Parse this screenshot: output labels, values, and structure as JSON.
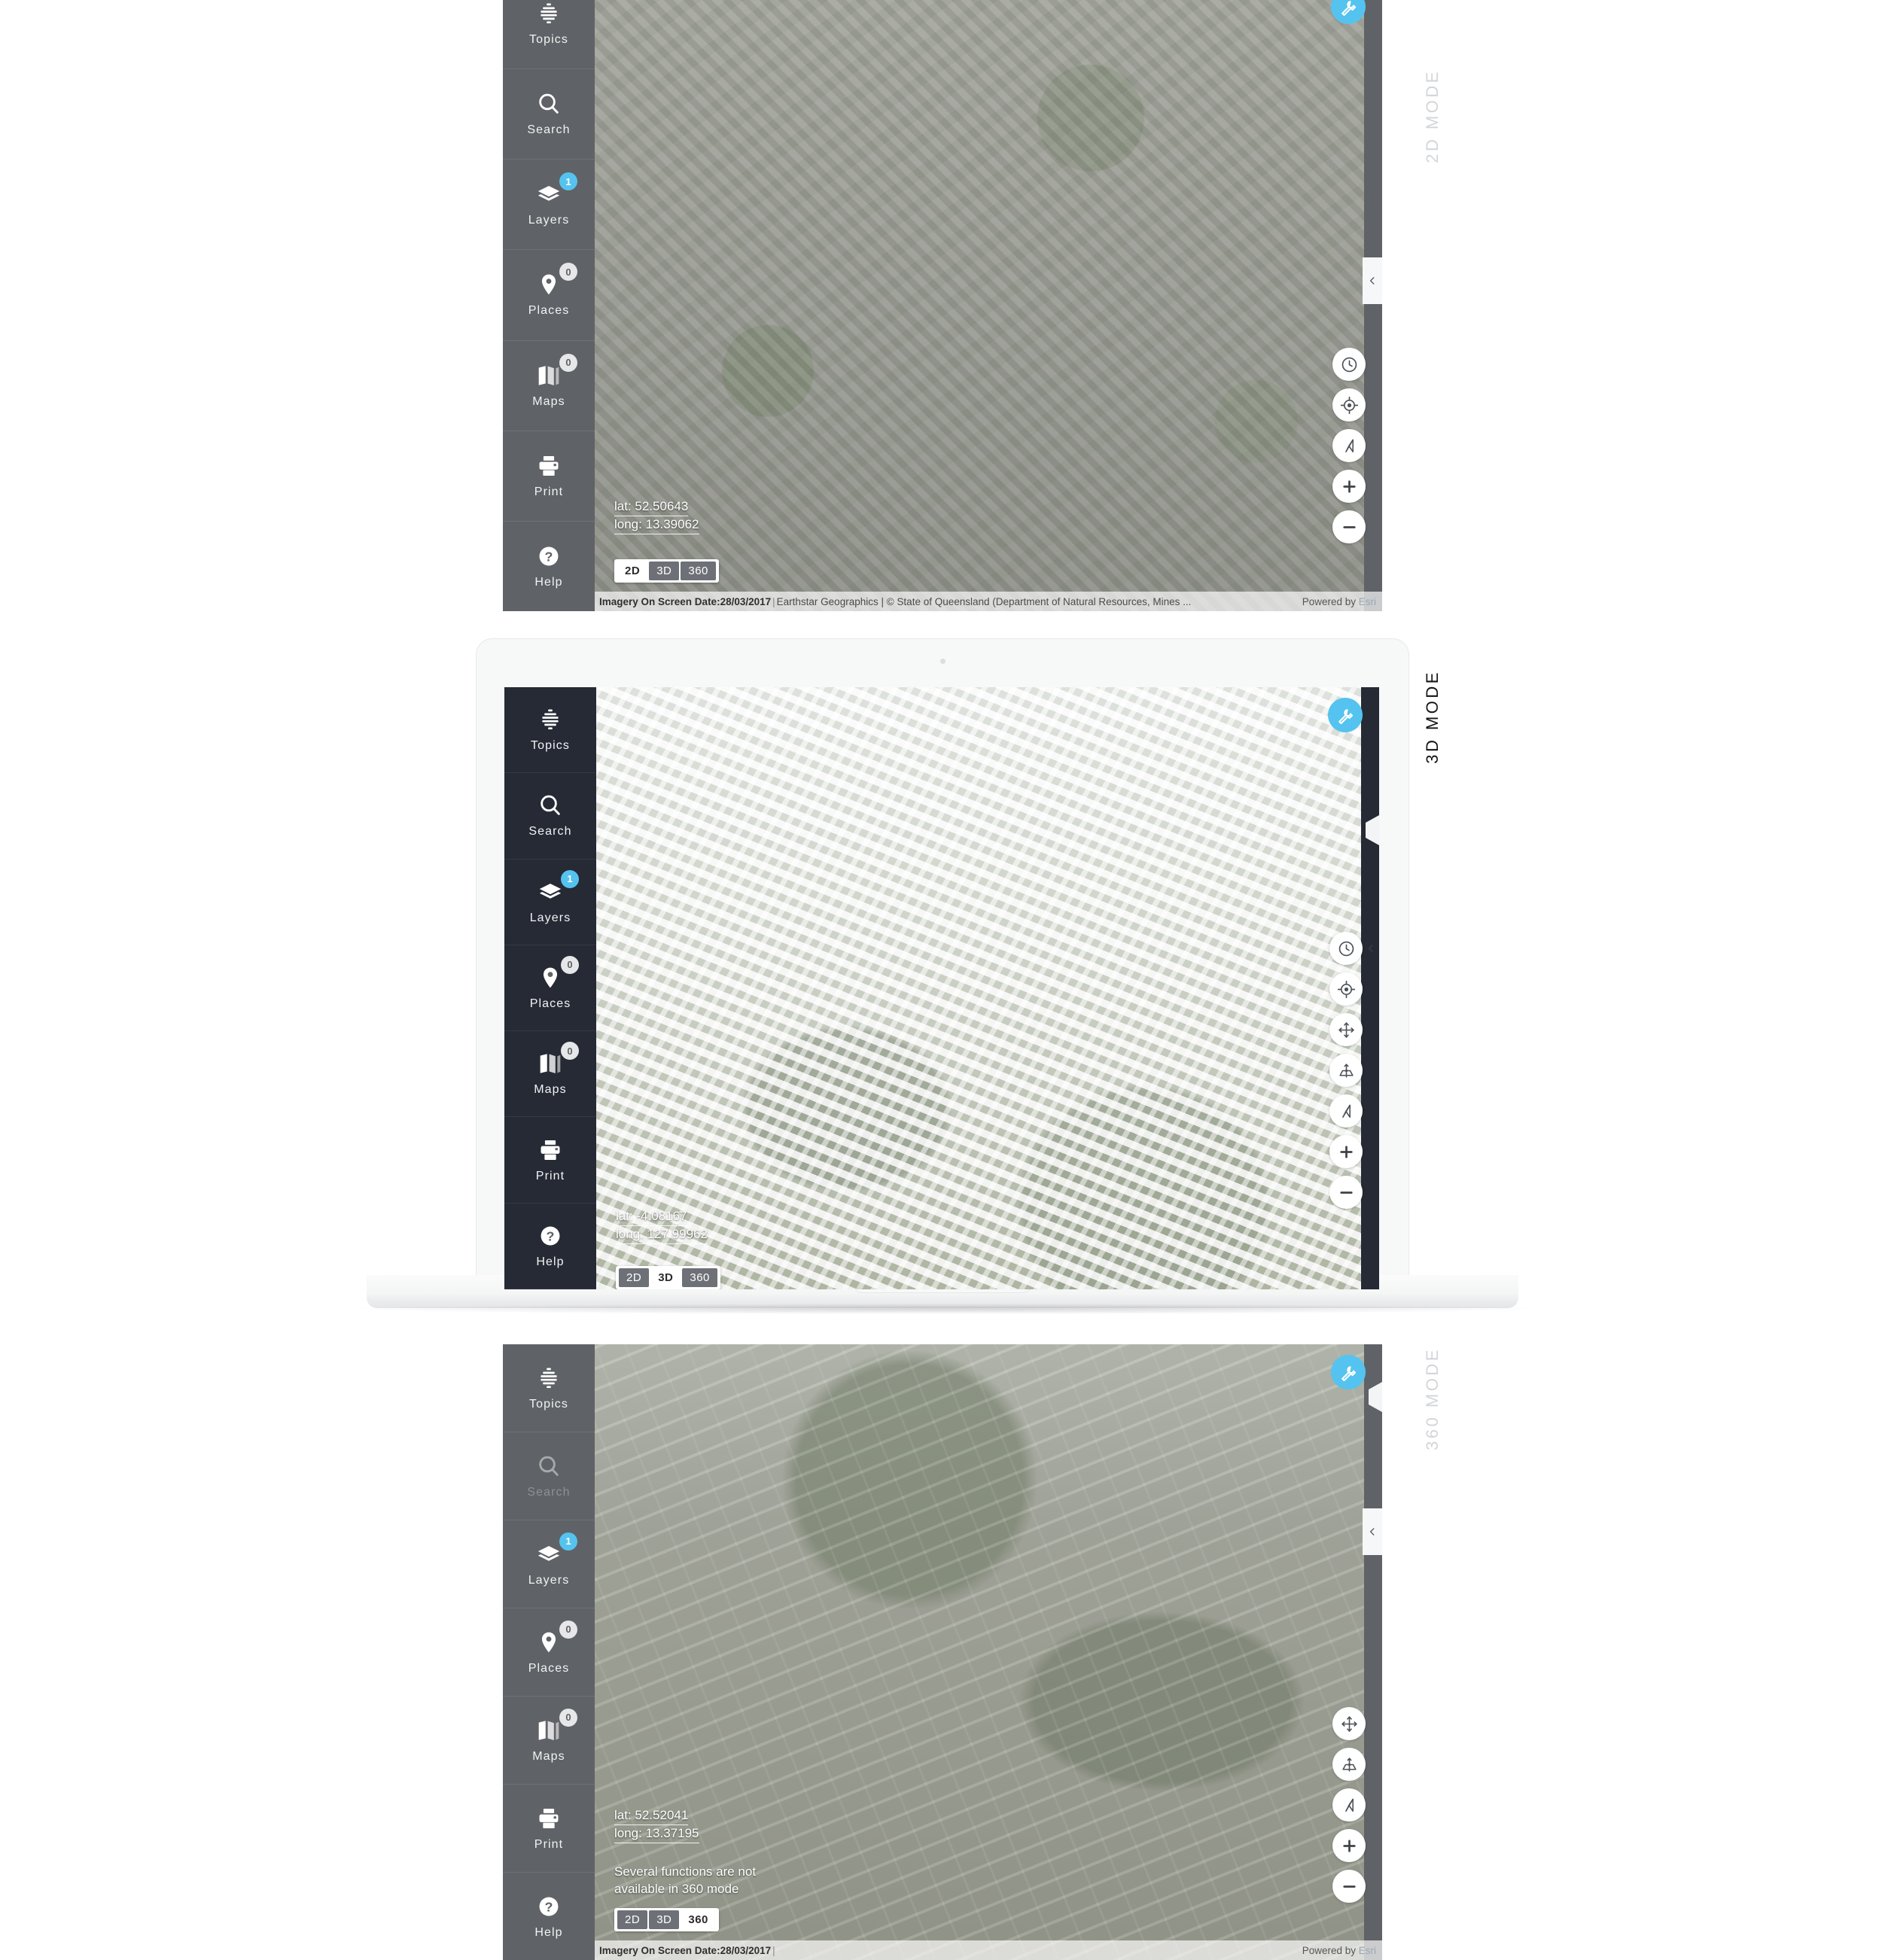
{
  "nav": {
    "items": [
      {
        "key": "topics",
        "label": "Topics",
        "icon": "topics-icon",
        "badge": null
      },
      {
        "key": "search",
        "label": "Search",
        "icon": "search-icon",
        "badge": null
      },
      {
        "key": "layers",
        "label": "Layers",
        "icon": "layers-icon",
        "badge": "1",
        "badge_color": "blue"
      },
      {
        "key": "places",
        "label": "Places",
        "icon": "place-pin-icon",
        "badge": "0",
        "badge_color": "gray"
      },
      {
        "key": "maps",
        "label": "Maps",
        "icon": "map-icon",
        "badge": "0",
        "badge_color": "gray"
      },
      {
        "key": "print",
        "label": "Print",
        "icon": "printer-icon",
        "badge": null
      },
      {
        "key": "help",
        "label": "Help",
        "icon": "help-icon",
        "badge": null
      }
    ]
  },
  "colors": {
    "accent_blue": "#55c3ef",
    "sidebar_gray": "#5f6266",
    "sidebar_dark": "#252a35",
    "badge_gray": "#e6e7e8"
  },
  "mode_labels": {
    "two_d": "2D MODE",
    "three_d": "3D MODE",
    "three_sixty": "360 MODE"
  },
  "mode_switch": {
    "options": [
      "2D",
      "3D",
      "360"
    ]
  },
  "panel_2d": {
    "active_mode": "2D",
    "lat": "lat: 52.50643",
    "long": "long: 13.39062",
    "tools_button": "wrench-icon",
    "controls": [
      "clock-icon",
      "locate-icon",
      "compass-icon",
      "zoom-in-icon",
      "zoom-out-icon"
    ],
    "attribution": {
      "imagery": "Imagery On Screen Date:28/03/2017",
      "sources": "Earthstar Geographics | © State of Queensland (Department of Natural Resources, Mines ...",
      "powered_prefix": "Powered by ",
      "powered_brand": "Esri"
    }
  },
  "panel_3d": {
    "active_mode": "3D",
    "lat": "lat: -4.08167",
    "long": "long: 127.99962",
    "tools_button": "wrench-icon",
    "controls": [
      "clock-icon",
      "locate-icon",
      "pan-icon",
      "tilt-icon",
      "compass-icon",
      "zoom-in-icon",
      "zoom-out-icon"
    ]
  },
  "panel_360": {
    "active_mode": "360",
    "lat": "lat: 52.52041",
    "long": "long: 13.37195",
    "notice": "Several functions are not available in 360 mode",
    "disabled_nav": "search",
    "tools_button": "wrench-icon",
    "controls": [
      "pan-icon",
      "tilt-icon",
      "compass-icon",
      "zoom-in-icon",
      "zoom-out-icon"
    ],
    "attribution": {
      "imagery": "Imagery On Screen Date:28/03/2017",
      "sources": "",
      "powered_prefix": "Powered by ",
      "powered_brand": "Esri"
    }
  }
}
